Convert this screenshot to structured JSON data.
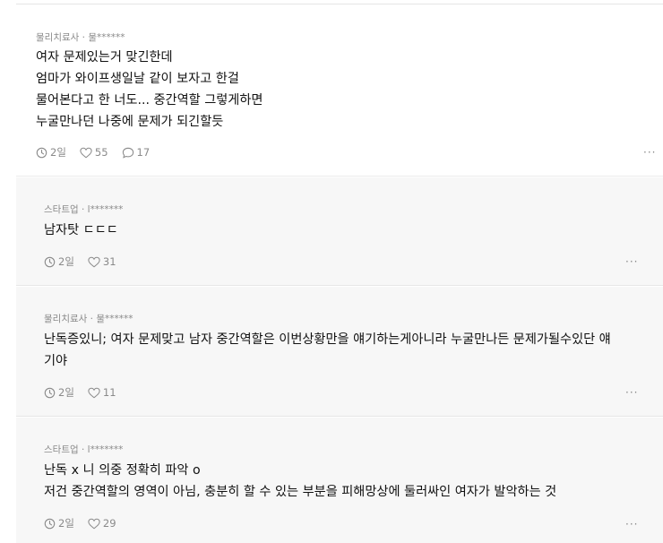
{
  "comments": [
    {
      "author": "물리치료사 · 물******",
      "lines": [
        "여자 문제있는거 맞긴한데",
        "엄마가 와이프생일날 같이 보자고 한걸",
        "물어본다고 한 너도... 중간역할 그렇게하면",
        "누굴만나던 나중에 문제가 되긴할듯"
      ],
      "time": "2일",
      "likes": "55",
      "replies": "17"
    },
    {
      "author": "스타트업 · l*******",
      "lines": [
        "남자탓 ㄷㄷㄷ"
      ],
      "time": "2일",
      "likes": "31"
    },
    {
      "author": "물리치료사 · 물******",
      "lines": [
        "난독증있니; 여자 문제맞고 남자 중간역할은 이번상황만을 얘기하는게아니라 누굴만나든 문제가될수있단 얘",
        "기야"
      ],
      "time": "2일",
      "likes": "11"
    },
    {
      "author": "스타트업 · l*******",
      "lines": [
        "난독 x 니 의중 정확히 파악 o",
        "저건 중간역할의 영역이 아님, 충분히 할 수 있는 부분을 피해망상에 둘러싸인 여자가 발악하는 것"
      ],
      "time": "2일",
      "likes": "29"
    }
  ],
  "more_label": "···",
  "icons": {
    "time": "clock-icon",
    "likes": "heart-icon",
    "replies": "speech-bubble-icon"
  },
  "colors": {
    "reply_bg": "#f7f7f7",
    "meta_text": "#8a8a8a",
    "divider": "#e6e6e6"
  }
}
